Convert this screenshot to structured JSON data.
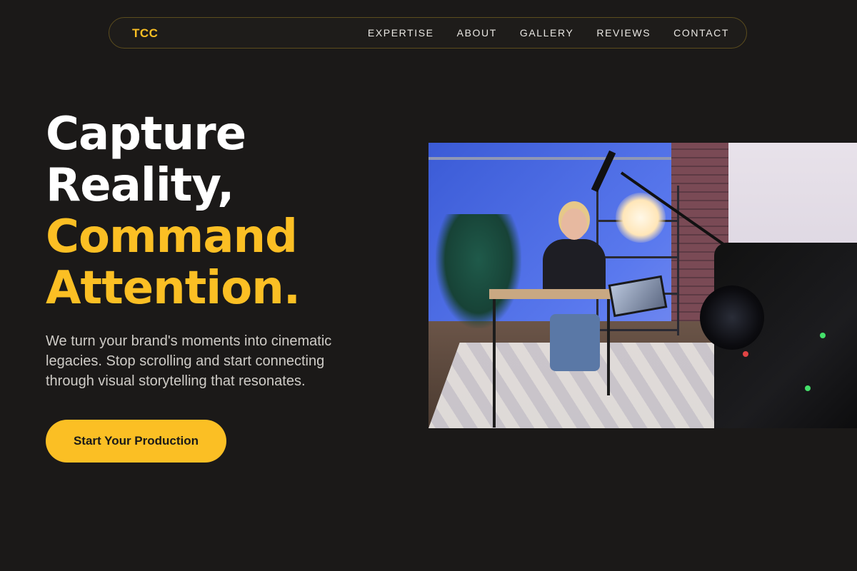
{
  "brand": {
    "logo": "TCC",
    "accent_color": "#fbbf24",
    "background_color": "#1b1918"
  },
  "nav": {
    "items": [
      {
        "label": "EXPERTISE"
      },
      {
        "label": "ABOUT"
      },
      {
        "label": "GALLERY"
      },
      {
        "label": "REVIEWS"
      },
      {
        "label": "CONTACT"
      }
    ]
  },
  "hero": {
    "headline_line1": "Capture",
    "headline_line2": "Reality,",
    "headline_line3": "Command",
    "headline_line4": "Attention.",
    "subtitle": "We turn your brand's moments into cinematic legacies. Stop scrolling and start connecting through visual storytelling that resonates.",
    "cta_label": "Start Your Production"
  }
}
